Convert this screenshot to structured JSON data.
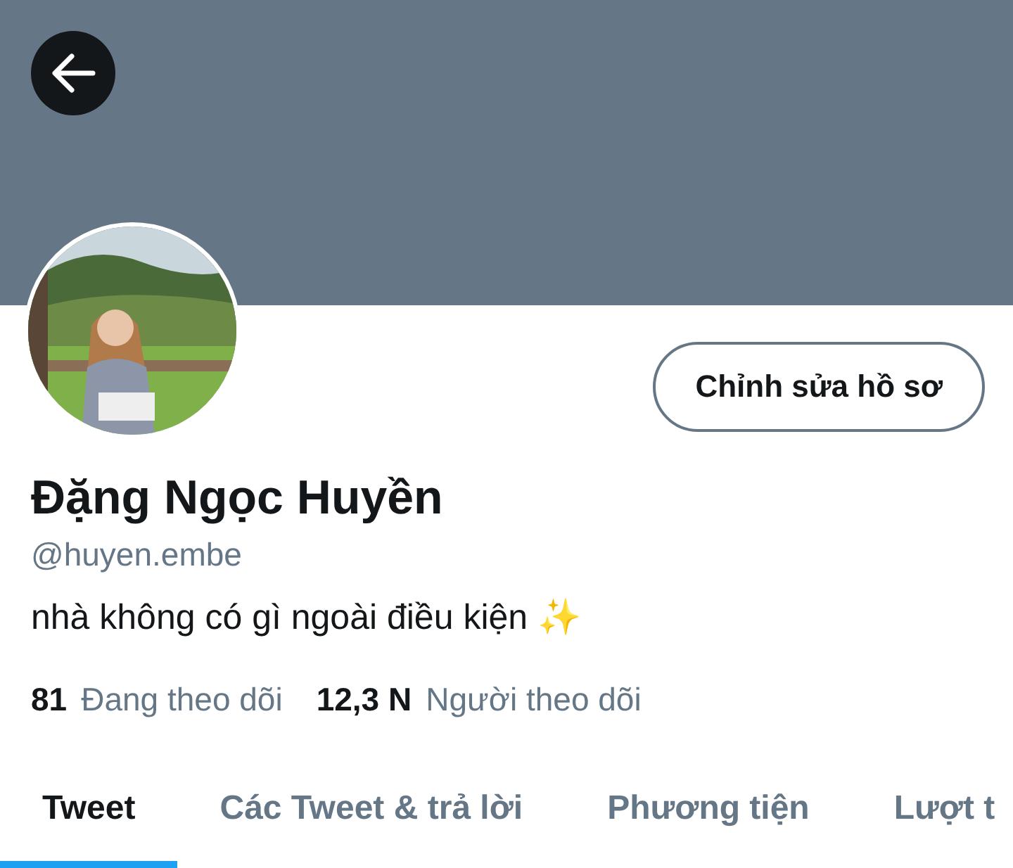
{
  "profile": {
    "name": "Đặng Ngọc Huyền",
    "handle": "@huyen.embe",
    "bio": "nhà không có gì ngoài điều kiện ✨"
  },
  "edit_button": "Chỉnh sửa hồ sơ",
  "stats": [
    {
      "count": "81",
      "label": "Đang theo dõi"
    },
    {
      "count": "12,3 N",
      "label": "Người theo dõi"
    }
  ],
  "tabs": [
    {
      "label": "Tweet",
      "selected": true
    },
    {
      "label": "Các Tweet & trả lời",
      "selected": false
    },
    {
      "label": "Phương tiện",
      "selected": false
    },
    {
      "label": "Lượt t",
      "selected": false
    }
  ]
}
